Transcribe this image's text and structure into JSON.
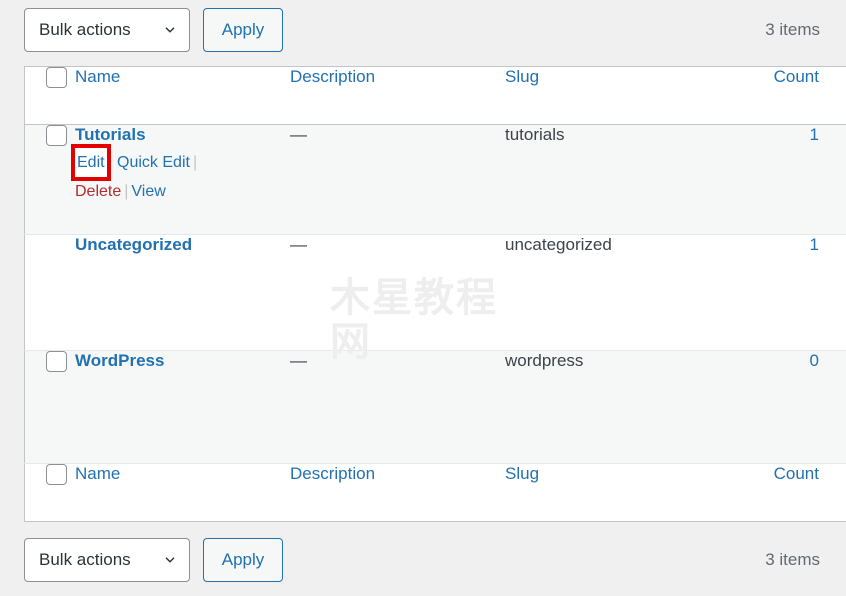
{
  "toolbar_top": {
    "bulk_actions_label": "Bulk actions",
    "bulk_actions_caret_icon": "chevron-down-icon",
    "apply_label": "Apply",
    "items_count": "3 items"
  },
  "toolbar_bottom": {
    "bulk_actions_label": "Bulk actions",
    "bulk_actions_caret_icon": "chevron-down-icon",
    "apply_label": "Apply",
    "items_count": "3 items"
  },
  "table": {
    "columns": {
      "cb": "",
      "name": "Name",
      "description": "Description",
      "slug": "Slug",
      "count": "Count"
    },
    "rows": [
      {
        "name": "Tutorials",
        "description": "—",
        "slug": "tutorials",
        "count": "1",
        "has_checkbox": true,
        "actions": {
          "edit": "Edit",
          "quick_edit": "Quick Edit",
          "delete": "Delete",
          "view": "View"
        }
      },
      {
        "name": "Uncategorized",
        "description": "—",
        "slug": "uncategorized",
        "count": "1",
        "has_checkbox": false,
        "actions": null
      },
      {
        "name": "WordPress",
        "description": "—",
        "slug": "wordpress",
        "count": "0",
        "has_checkbox": true,
        "actions": null
      }
    ]
  },
  "watermark": {
    "text": "木星教程网"
  },
  "colors": {
    "link_blue": "#2271b1",
    "delete_red": "#b32d2e",
    "highlight_red": "#e20000",
    "page_bg": "#f0f0f1",
    "row_alt_bg": "#f6f7f7",
    "border": "#c3c4c7"
  }
}
